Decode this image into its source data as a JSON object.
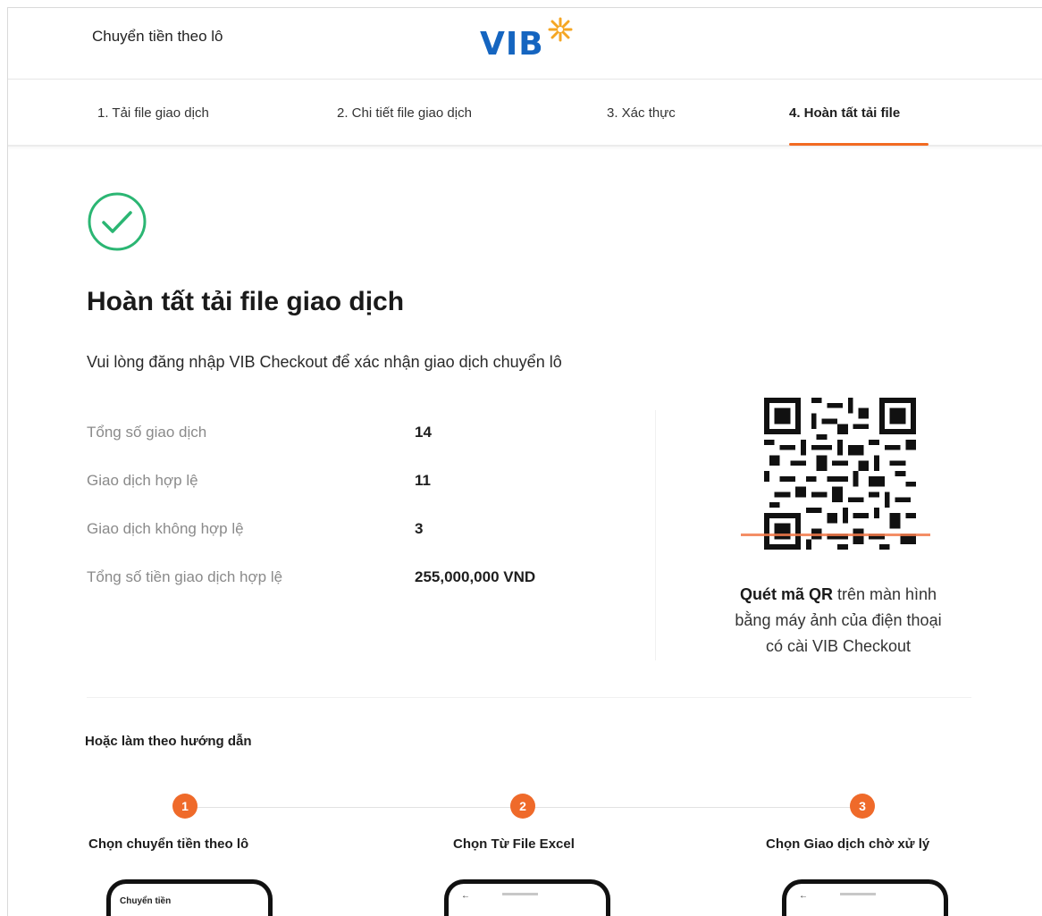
{
  "header": {
    "title": "Chuyển tiền theo lô",
    "logo_text": "VIB"
  },
  "steps": [
    {
      "label": "1. Tải file giao dịch",
      "active": false
    },
    {
      "label": "2. Chi tiết file giao dịch",
      "active": false
    },
    {
      "label": "3. Xác thực",
      "active": false
    },
    {
      "label": "4. Hoàn tất tải file",
      "active": true
    }
  ],
  "result": {
    "title": "Hoàn tất tải file giao dịch",
    "subtitle": "Vui lòng đăng nhập VIB Checkout để xác nhận giao dịch chuyển lô"
  },
  "summary": [
    {
      "label": "Tổng số giao dịch",
      "value": "14"
    },
    {
      "label": "Giao dịch hợp lệ",
      "value": "11"
    },
    {
      "label": "Giao dịch không hợp lệ",
      "value": "3"
    },
    {
      "label": "Tổng số tiền giao dịch hợp lệ",
      "value": "255,000,000 VND"
    }
  ],
  "qr": {
    "caption_bold": "Quét mã QR",
    "caption_line1_rest": " trên màn hình",
    "caption_line2": "bằng máy ảnh của điện thoại",
    "caption_line3": "có cài VIB Checkout"
  },
  "guide": {
    "title": "Hoặc làm theo hướng dẫn",
    "steps": [
      {
        "number": "1",
        "label": "Chọn chuyển tiền theo lô",
        "phone_text": "Chuyển tiền"
      },
      {
        "number": "2",
        "label": "Chọn Từ File Excel",
        "phone_text": "←"
      },
      {
        "number": "3",
        "label": "Chọn Giao dịch chờ xử lý",
        "phone_text": "←"
      }
    ]
  },
  "colors": {
    "brand_blue": "#1565c0",
    "accent_orange": "#f26a21",
    "success_green": "#2bb673"
  }
}
